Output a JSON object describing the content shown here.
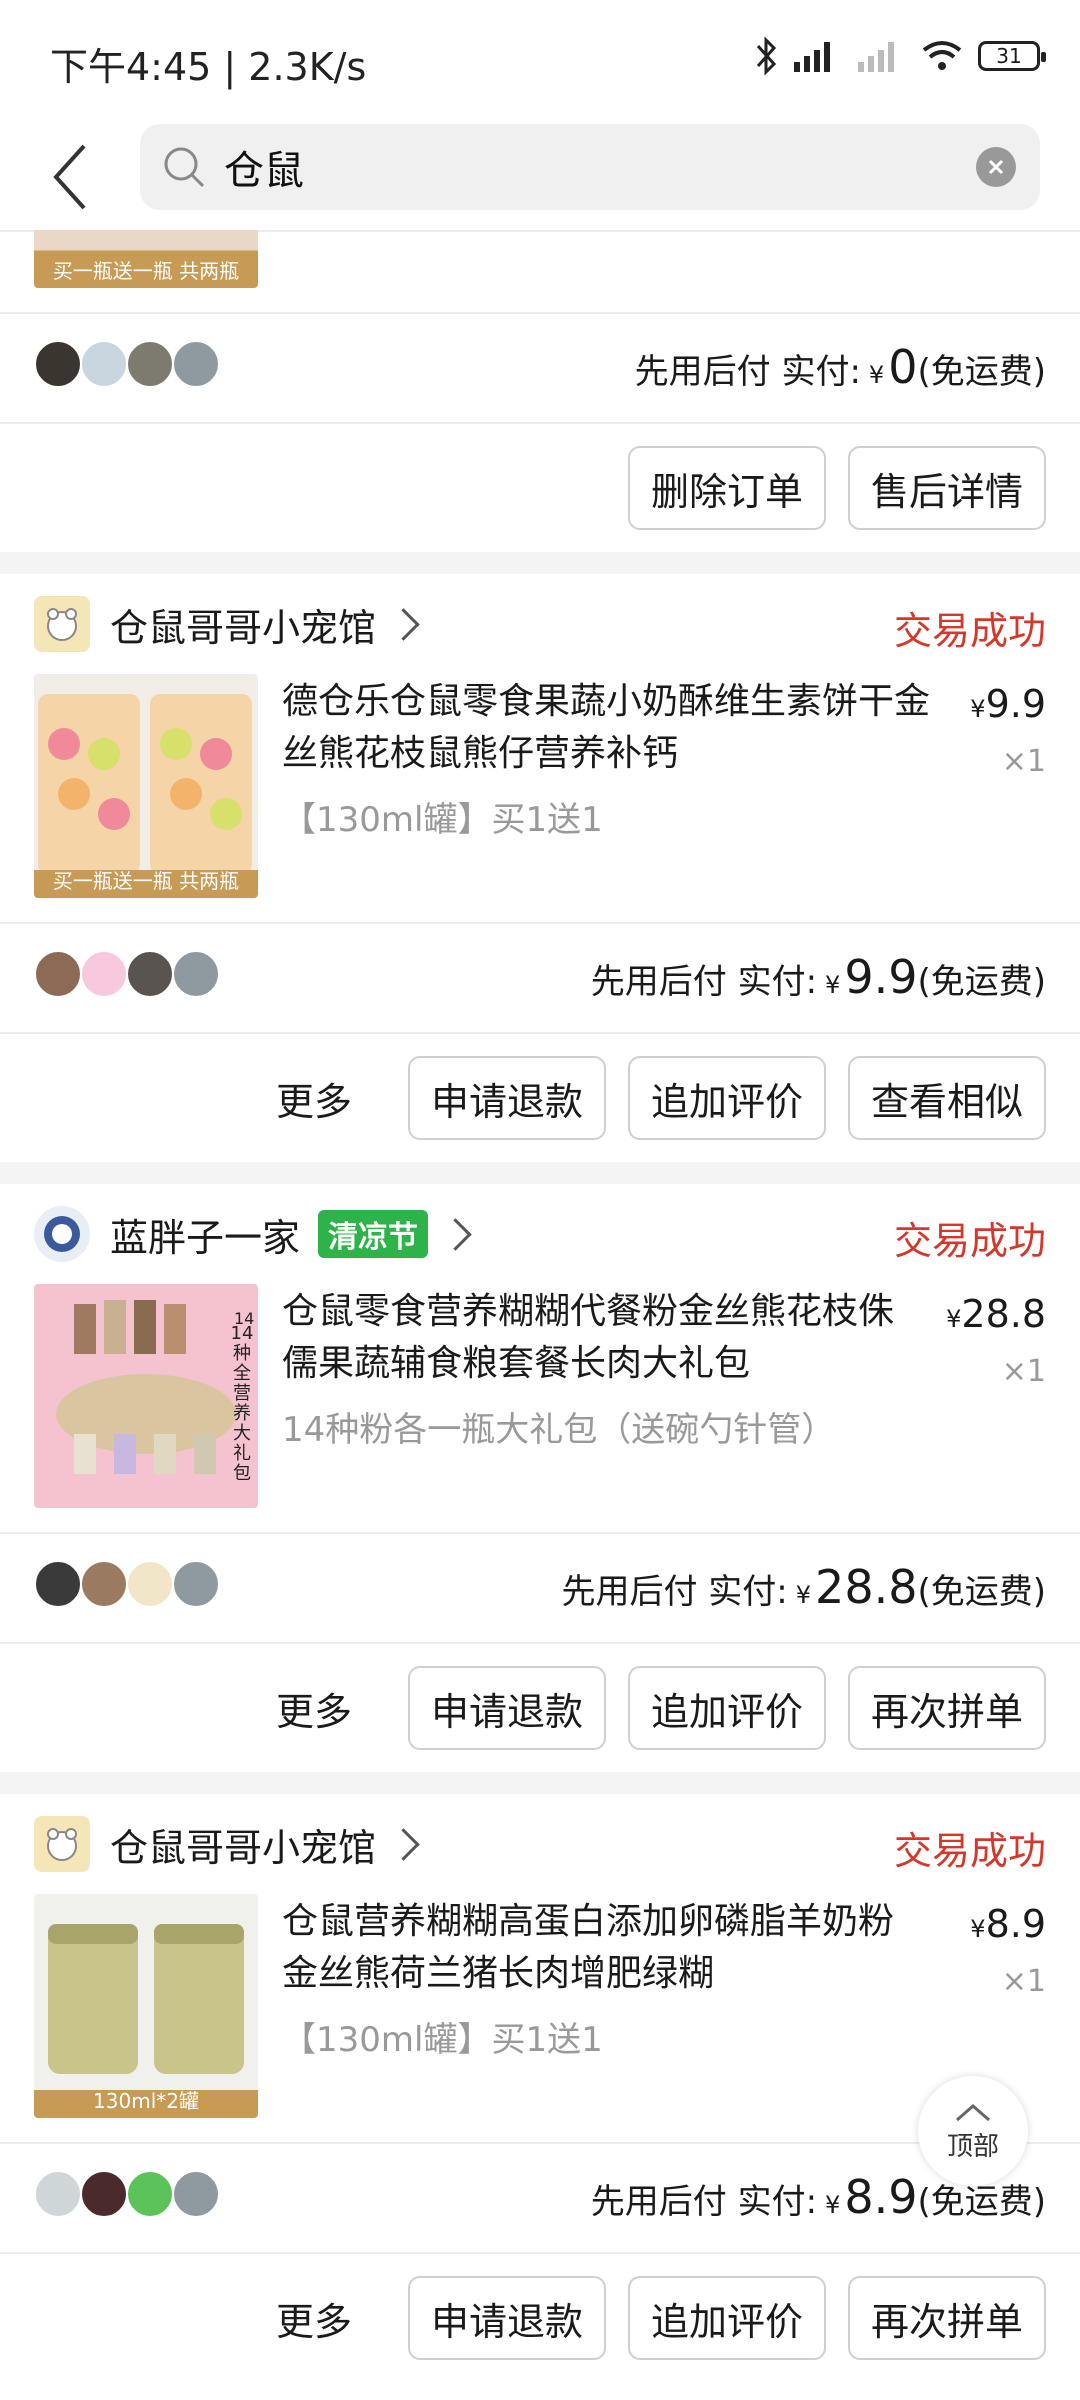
{
  "status_bar": {
    "time": "下午4:45 | 2.3K/s",
    "battery": "31"
  },
  "search": {
    "query": "仓鼠"
  },
  "partial_card": {
    "thumb_label": "买一瓶送一瓶 共两瓶",
    "pay_prefix": "先用后付 实付:",
    "yen": "¥",
    "amount": "0",
    "shipping": "(免运费)",
    "buttons": [
      "删除订单",
      "售后详情"
    ]
  },
  "orders": [
    {
      "shop": "仓鼠哥哥小宠馆",
      "status": "交易成功",
      "title": "德仓乐仓鼠零食果蔬小奶酥维生素饼干金丝熊花枝鼠熊仔营养补钙",
      "spec": "【130ml罐】买1送1",
      "price": "9.9",
      "qty": "×1",
      "img_label": "买一瓶送一瓶 共两瓶",
      "pay_prefix": "先用后付 实付:",
      "yen": "¥",
      "amount": "9.9",
      "shipping": "(免运费)",
      "more": "更多",
      "buttons": [
        "申请退款",
        "追加评价",
        "查看相似"
      ]
    },
    {
      "shop": "蓝胖子一家",
      "promo": "清凉节",
      "status": "交易成功",
      "title": "仓鼠零食营养糊糊代餐粉金丝熊花枝侏儒果蔬辅食粮套餐长肉大礼包",
      "spec": "14种粉各一瓶大礼包（送碗勺针管）",
      "price": "28.8",
      "qty": "×1",
      "img_label": "14种全营养大礼包",
      "pay_prefix": "先用后付 实付:",
      "yen": "¥",
      "amount": "28.8",
      "shipping": "(免运费)",
      "more": "更多",
      "buttons": [
        "申请退款",
        "追加评价",
        "再次拼单"
      ]
    },
    {
      "shop": "仓鼠哥哥小宠馆",
      "status": "交易成功",
      "title": "仓鼠营养糊糊高蛋白添加卵磷脂羊奶粉金丝熊荷兰猪长肉增肥绿糊",
      "spec": "【130ml罐】买1送1",
      "price": "8.9",
      "qty": "×1",
      "img_label": "130ml*2罐",
      "pay_prefix": "先用后付 实付:",
      "yen": "¥",
      "amount": "8.9",
      "shipping": "(免运费)",
      "more": "更多",
      "buttons": [
        "申请退款",
        "追加评价",
        "再次拼单"
      ]
    }
  ],
  "back_to_top": "顶部",
  "colors": {
    "success_red": "#d4382b",
    "promo_green": "#2eb34a"
  }
}
